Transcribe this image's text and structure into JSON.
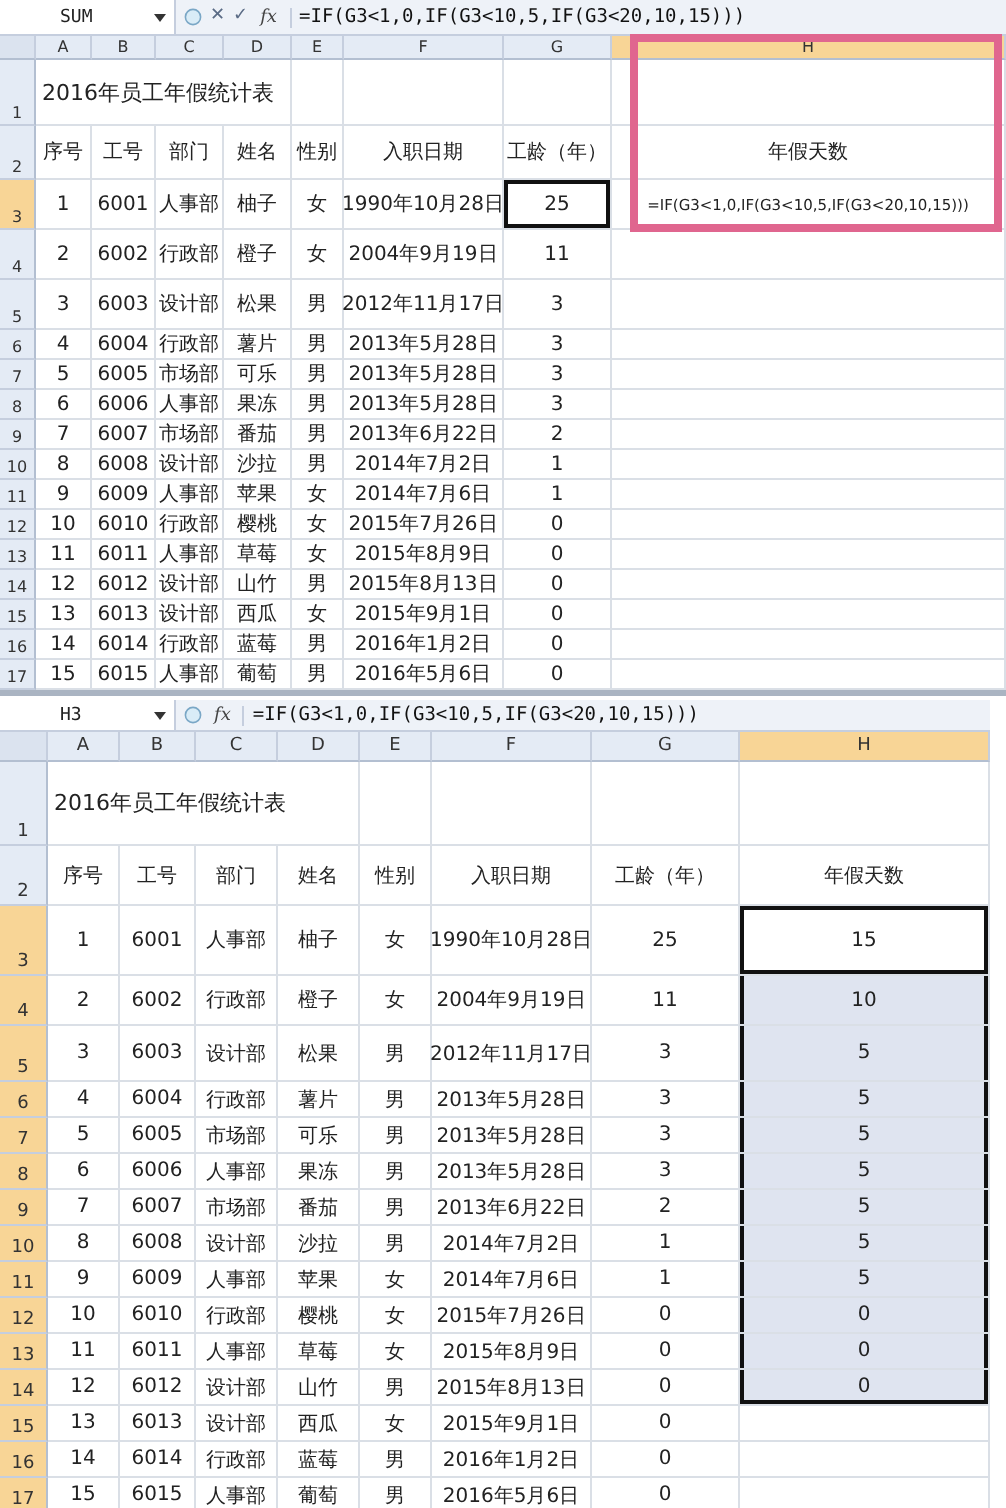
{
  "sheets": [
    {
      "name_box": "SUM",
      "controls": [
        "✕",
        "✓"
      ],
      "fx": "fx",
      "formula": "=IF(G3<1,0,IF(G3<10,5,IF(G3<20,10,15)))",
      "callout": true,
      "columns": [
        {
          "label": "A",
          "selected": false,
          "active": false
        },
        {
          "label": "B",
          "selected": false,
          "active": false
        },
        {
          "label": "C",
          "selected": false,
          "active": false
        },
        {
          "label": "D",
          "selected": false,
          "active": false
        },
        {
          "label": "E",
          "selected": false,
          "active": false
        },
        {
          "label": "F",
          "selected": false,
          "active": false
        },
        {
          "label": "G",
          "selected": false,
          "active": true
        },
        {
          "label": "H",
          "selected": true,
          "active": false
        }
      ],
      "title_row": {
        "label": "1",
        "selected": false,
        "title": "2016年员工年假统计表"
      },
      "header_row": {
        "label": "2",
        "selected": false,
        "cells": [
          "序号",
          "工号",
          "部门",
          "姓名",
          "性别",
          "入职日期",
          "工龄（年）",
          "年假天数"
        ]
      },
      "rows": [
        {
          "label": "3",
          "selected": true,
          "active": true,
          "cells": [
            "1",
            "6001",
            "人事部",
            "柚子",
            "女",
            "1990年10月28日",
            "25",
            "=IF(G3<1,0,IF(G3<10,5,IF(G3<20,10,15)))"
          ]
        },
        {
          "label": "4",
          "selected": false,
          "active": false,
          "cells": [
            "2",
            "6002",
            "行政部",
            "橙子",
            "女",
            "2004年9月19日",
            "11"
          ]
        },
        {
          "label": "5",
          "selected": false,
          "active": false,
          "cells": [
            "3",
            "6003",
            "设计部",
            "松果",
            "男",
            "2012年11月17日",
            "3"
          ]
        },
        {
          "label": "6",
          "selected": false,
          "active": false,
          "cells": [
            "4",
            "6004",
            "行政部",
            "薯片",
            "男",
            "2013年5月28日",
            "3"
          ]
        },
        {
          "label": "7",
          "selected": false,
          "active": false,
          "cells": [
            "5",
            "6005",
            "市场部",
            "可乐",
            "男",
            "2013年5月28日",
            "3"
          ]
        },
        {
          "label": "8",
          "selected": false,
          "active": false,
          "cells": [
            "6",
            "6006",
            "人事部",
            "果冻",
            "男",
            "2013年5月28日",
            "3"
          ]
        },
        {
          "label": "9",
          "selected": false,
          "active": false,
          "cells": [
            "7",
            "6007",
            "市场部",
            "番茄",
            "男",
            "2013年6月22日",
            "2"
          ]
        },
        {
          "label": "10",
          "selected": false,
          "active": false,
          "cells": [
            "8",
            "6008",
            "设计部",
            "沙拉",
            "男",
            "2014年7月2日",
            "1"
          ]
        },
        {
          "label": "11",
          "selected": false,
          "active": false,
          "cells": [
            "9",
            "6009",
            "人事部",
            "苹果",
            "女",
            "2014年7月6日",
            "1"
          ]
        },
        {
          "label": "12",
          "selected": false,
          "active": false,
          "cells": [
            "10",
            "6010",
            "行政部",
            "樱桃",
            "女",
            "2015年7月26日",
            "0"
          ]
        },
        {
          "label": "13",
          "selected": false,
          "active": false,
          "cells": [
            "11",
            "6011",
            "人事部",
            "草莓",
            "女",
            "2015年8月9日",
            "0"
          ]
        },
        {
          "label": "14",
          "selected": false,
          "active": false,
          "cells": [
            "12",
            "6012",
            "设计部",
            "山竹",
            "男",
            "2015年8月13日",
            "0"
          ]
        },
        {
          "label": "15",
          "selected": false,
          "active": false,
          "cells": [
            "13",
            "6013",
            "设计部",
            "西瓜",
            "女",
            "2015年9月1日",
            "0"
          ]
        },
        {
          "label": "16",
          "selected": false,
          "active": false,
          "cells": [
            "14",
            "6014",
            "行政部",
            "蓝莓",
            "男",
            "2016年1月2日",
            "0"
          ]
        },
        {
          "label": "17",
          "selected": false,
          "active": false,
          "cells": [
            "15",
            "6015",
            "人事部",
            "葡萄",
            "男",
            "2016年5月6日",
            "0"
          ]
        }
      ]
    },
    {
      "name_box": "H3",
      "fx": "fx",
      "formula": "=IF(G3<1,0,IF(G3<10,5,IF(G3<20,10,15)))",
      "columns": [
        {
          "label": "A",
          "selected": false,
          "active": false
        },
        {
          "label": "B",
          "selected": false,
          "active": false
        },
        {
          "label": "C",
          "selected": false,
          "active": false
        },
        {
          "label": "D",
          "selected": false,
          "active": false
        },
        {
          "label": "E",
          "selected": false,
          "active": false
        },
        {
          "label": "F",
          "selected": false,
          "active": false
        },
        {
          "label": "G",
          "selected": false,
          "active": false
        },
        {
          "label": "H",
          "selected": true,
          "active": true
        }
      ],
      "title_row": {
        "label": "1",
        "selected": false,
        "title": "2016年员工年假统计表"
      },
      "header_row": {
        "label": "2",
        "selected": false,
        "cells": [
          "序号",
          "工号",
          "部门",
          "姓名",
          "性别",
          "入职日期",
          "工龄（年）",
          "年假天数"
        ]
      },
      "rows": [
        {
          "label": "3",
          "selected": true,
          "active": true,
          "in_range": true,
          "cells": [
            "1",
            "6001",
            "人事部",
            "柚子",
            "女",
            "1990年10月28日",
            "25",
            "15"
          ]
        },
        {
          "label": "4",
          "selected": true,
          "active": false,
          "in_range": true,
          "cells": [
            "2",
            "6002",
            "行政部",
            "橙子",
            "女",
            "2004年9月19日",
            "11",
            "10"
          ]
        },
        {
          "label": "5",
          "selected": true,
          "active": false,
          "in_range": true,
          "cells": [
            "3",
            "6003",
            "设计部",
            "松果",
            "男",
            "2012年11月17日",
            "3",
            "5"
          ]
        },
        {
          "label": "6",
          "selected": true,
          "active": false,
          "in_range": true,
          "cells": [
            "4",
            "6004",
            "行政部",
            "薯片",
            "男",
            "2013年5月28日",
            "3",
            "5"
          ]
        },
        {
          "label": "7",
          "selected": true,
          "active": false,
          "in_range": true,
          "cells": [
            "5",
            "6005",
            "市场部",
            "可乐",
            "男",
            "2013年5月28日",
            "3",
            "5"
          ]
        },
        {
          "label": "8",
          "selected": true,
          "active": false,
          "in_range": true,
          "cells": [
            "6",
            "6006",
            "人事部",
            "果冻",
            "男",
            "2013年5月28日",
            "3",
            "5"
          ]
        },
        {
          "label": "9",
          "selected": true,
          "active": false,
          "in_range": true,
          "cells": [
            "7",
            "6007",
            "市场部",
            "番茄",
            "男",
            "2013年6月22日",
            "2",
            "5"
          ]
        },
        {
          "label": "10",
          "selected": true,
          "active": false,
          "in_range": true,
          "cells": [
            "8",
            "6008",
            "设计部",
            "沙拉",
            "男",
            "2014年7月2日",
            "1",
            "5"
          ]
        },
        {
          "label": "11",
          "selected": true,
          "active": false,
          "in_range": true,
          "cells": [
            "9",
            "6009",
            "人事部",
            "苹果",
            "女",
            "2014年7月6日",
            "1",
            "5"
          ]
        },
        {
          "label": "12",
          "selected": true,
          "active": false,
          "in_range": true,
          "cells": [
            "10",
            "6010",
            "行政部",
            "樱桃",
            "女",
            "2015年7月26日",
            "0",
            "0"
          ]
        },
        {
          "label": "13",
          "selected": true,
          "active": false,
          "in_range": true,
          "cells": [
            "11",
            "6011",
            "人事部",
            "草莓",
            "女",
            "2015年8月9日",
            "0",
            "0"
          ]
        },
        {
          "label": "14",
          "selected": true,
          "active": false,
          "in_range": true,
          "cells": [
            "12",
            "6012",
            "设计部",
            "山竹",
            "男",
            "2015年8月13日",
            "0",
            "0"
          ]
        },
        {
          "label": "15",
          "selected": true,
          "active": false,
          "in_range": false,
          "cells": [
            "13",
            "6013",
            "设计部",
            "西瓜",
            "女",
            "2015年9月1日",
            "0"
          ]
        },
        {
          "label": "16",
          "selected": true,
          "active": false,
          "in_range": false,
          "cells": [
            "14",
            "6014",
            "行政部",
            "蓝莓",
            "男",
            "2016年1月2日",
            "0"
          ]
        },
        {
          "label": "17",
          "selected": true,
          "active": false,
          "in_range": false,
          "cells": [
            "15",
            "6015",
            "人事部",
            "葡萄",
            "男",
            "2016年5月6日",
            "0"
          ]
        }
      ]
    }
  ]
}
